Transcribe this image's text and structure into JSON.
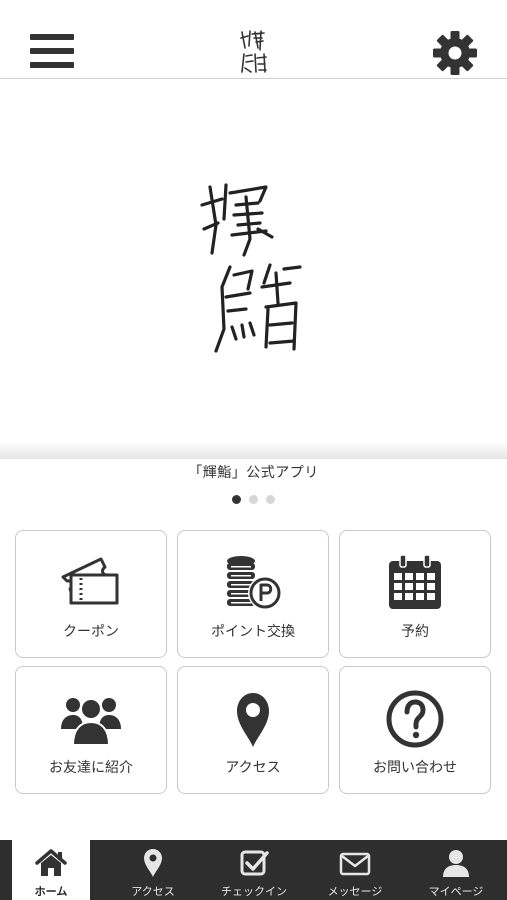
{
  "header": {
    "menu_icon": "hamburger-menu-icon",
    "settings_icon": "gear-icon"
  },
  "hero": {
    "caption": "「輝鮨」公式アプリ",
    "slides_total": 3,
    "slide_active": 1
  },
  "menu": [
    {
      "label": "クーポン",
      "icon": "ticket-icon"
    },
    {
      "label": "ポイント交換",
      "icon": "coins-point-icon"
    },
    {
      "label": "予約",
      "icon": "calendar-icon"
    },
    {
      "label": "お友達に紹介",
      "icon": "people-group-icon"
    },
    {
      "label": "アクセス",
      "icon": "map-pin-icon"
    },
    {
      "label": "お問い合わせ",
      "icon": "question-circle-icon"
    }
  ],
  "tabbar": [
    {
      "label": "ホーム",
      "icon": "home-icon",
      "active": true
    },
    {
      "label": "アクセス",
      "icon": "map-pin-icon",
      "active": false
    },
    {
      "label": "チェックイン",
      "icon": "checkbox-icon",
      "active": false
    },
    {
      "label": "メッセージ",
      "icon": "envelope-icon",
      "active": false
    },
    {
      "label": "マイページ",
      "icon": "person-icon",
      "active": false
    }
  ],
  "colors": {
    "tabbar_bg": "#2e2e2e",
    "icon_dark": "#333333",
    "border": "#c9c9c9"
  }
}
